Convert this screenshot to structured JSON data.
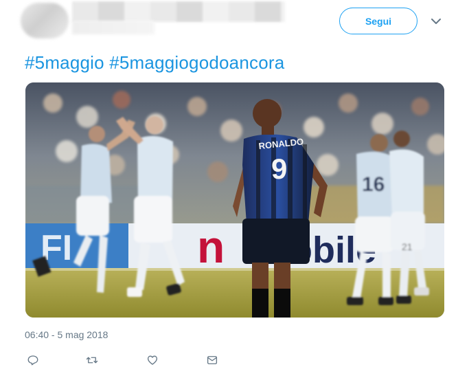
{
  "header": {
    "follow_label": "Segui"
  },
  "tweet": {
    "hashtags": [
      "#5maggio",
      "#5maggiogodoancora"
    ],
    "timestamp": "06:40 - 5 mag 2018"
  },
  "media": {
    "jersey_name": "RONALDO",
    "jersey_number": "9",
    "player_number_left": "16",
    "player_number_right": "21",
    "banner_text_left": "n",
    "banner_text_right": "obile"
  },
  "icons": [
    "reply-icon",
    "retweet-icon",
    "like-icon",
    "message-icon",
    "chevron-down-icon"
  ],
  "colors": {
    "accent": "#1da1f2",
    "hashtag": "#1b95e0",
    "meta": "#657786"
  }
}
